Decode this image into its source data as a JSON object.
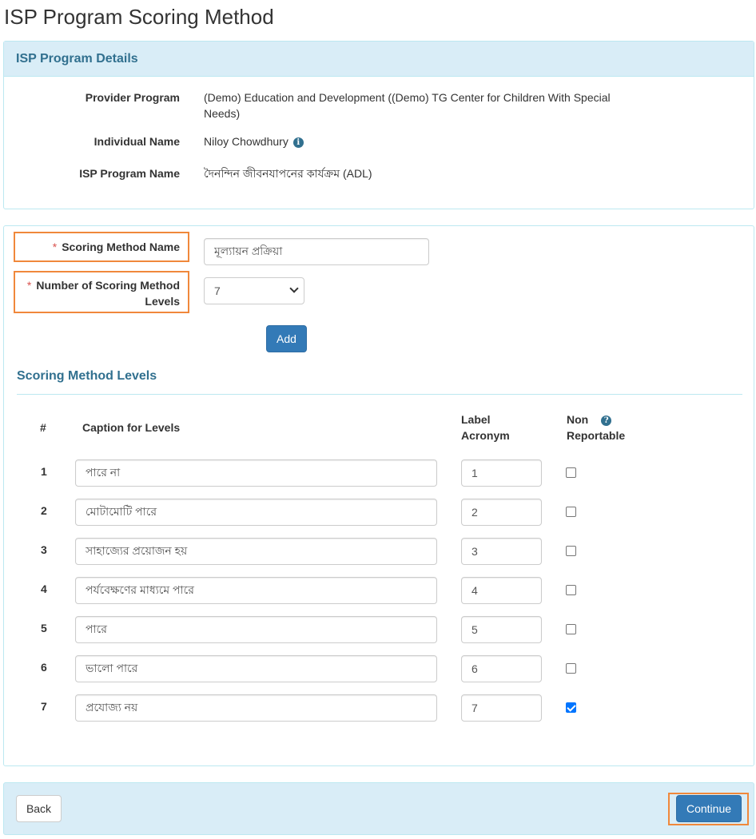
{
  "page": {
    "title": "ISP Program Scoring Method"
  },
  "details": {
    "heading": "ISP Program Details",
    "provider_program_label": "Provider Program",
    "provider_program_value": "(Demo) Education and Development ((Demo) TG Center for Children With Special Needs)",
    "individual_name_label": "Individual Name",
    "individual_name_value": "Niloy Chowdhury",
    "isp_program_name_label": "ISP Program Name",
    "isp_program_name_value": "দৈনন্দিন জীবনযাপনের কার্যক্রম (ADL)"
  },
  "form": {
    "required_marker": "*",
    "scoring_method_name_label": "Scoring Method Name",
    "scoring_method_name_value": "মূল্যায়ন প্রক্রিয়া",
    "levels_label_line1": "Number of Scoring Method",
    "levels_label_line2": "Levels",
    "levels_selected": "7",
    "add_button": "Add"
  },
  "levels_section": {
    "title": "Scoring Method Levels",
    "headers": {
      "num": "#",
      "caption": "Caption for Levels",
      "acronym_line1": "Label",
      "acronym_line2": "Acronym",
      "nonrep_line1": "Non",
      "nonrep_line2": "Reportable"
    },
    "rows": [
      {
        "num": "1",
        "caption": "পারে না",
        "acronym": "1",
        "non_reportable": false
      },
      {
        "num": "2",
        "caption": "মোটামোটি পারে",
        "acronym": "2",
        "non_reportable": false
      },
      {
        "num": "3",
        "caption": "সাহাজ্যের প্রয়োজন হয়",
        "acronym": "3",
        "non_reportable": false
      },
      {
        "num": "4",
        "caption": "পর্যবেক্ষণের মাধ্যমে পারে",
        "acronym": "4",
        "non_reportable": false
      },
      {
        "num": "5",
        "caption": "পারে",
        "acronym": "5",
        "non_reportable": false
      },
      {
        "num": "6",
        "caption": "ভালো পারে",
        "acronym": "6",
        "non_reportable": false
      },
      {
        "num": "7",
        "caption": "প্রযোজ্য নয়",
        "acronym": "7",
        "non_reportable": true
      }
    ]
  },
  "footer": {
    "back_button": "Back",
    "continue_button": "Continue"
  },
  "icons": {
    "info": "info-circle-icon",
    "help": "question-circle-icon",
    "caret": "chevron-down-icon"
  },
  "colors": {
    "accent": "#337ab7",
    "panel_heading": "#d9edf7",
    "highlight": "#f0883b",
    "heading_text": "#31708f"
  }
}
